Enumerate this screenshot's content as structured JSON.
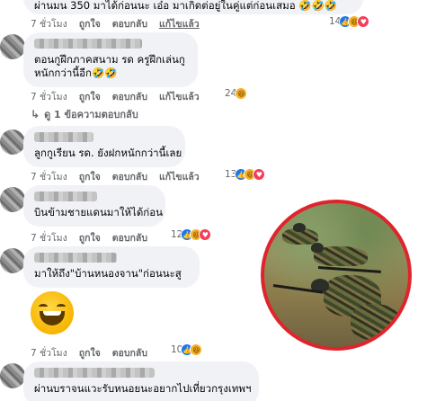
{
  "comments": [
    {
      "text": "ผ่านมน 350 มาได้ก่อนนะ เอ๋อ มาเกิดต่อยู่ในคู่แต่ก่อนเสมอ 🤣🤣🤣",
      "time": "7 ชั่วโมง",
      "like": "ถูกใจ",
      "reply": "ตอบกลับ",
      "edited": "แก้ไขแล้ว",
      "reaction_count": "14"
    },
    {
      "text": "ตอนกูฝึกภาคสนาม รด ครูฝึกเล่นกู หนักกว่านี้อีก 🤣🤣",
      "text_line1": "ตอนกูฝึกภาคสนาม รด ครูฝึกเล่นกู",
      "text_line2": "หนักกว่านี้อีก🤣🤣",
      "time": "7 ชั่วโมง",
      "like": "ถูกใจ",
      "reply": "ตอบกลับ",
      "edited": "แก้ไขแล้ว",
      "reaction_count": "24"
    },
    {
      "text": "ลูกกูเรียน รด. ยังฝกหนักกว่านี้เลย",
      "time": "7 ชั่วโมง",
      "like": "ถูกใจ",
      "reply": "ตอบกลับ",
      "edited": "แก้ไขแล้ว",
      "reaction_count": "13"
    },
    {
      "text": "บินข้ามชายแดนมาให้ได้ก่อน",
      "time": "7 ชั่วโมง",
      "like": "ถูกใจ",
      "reply": "ตอบกลับ",
      "reaction_count": "12"
    },
    {
      "text": "มาให้ถึง\"บ้านหนองจาน\"ก่อนนะสู",
      "time": "7 ชั่วโมง",
      "like": "ถูกใจ",
      "reply": "ตอบกลับ",
      "reaction_count": "10"
    },
    {
      "text": "ผ่านบราจนแวะรับหนอยนะอยากไปเที่ยวกรุงเทพฯ"
    }
  ],
  "view_replies": "ดู 1 ข้อความตอบกลับ",
  "icons": {
    "like": "like-reaction-icon",
    "haha": "haha-reaction-icon",
    "love": "love-reaction-icon",
    "reply_arrow": "reply-arrow-icon",
    "sticker": "laughing-emoji-sticker"
  },
  "colors": {
    "bubble": "#f0f2f5",
    "meta": "#65676b",
    "like": "#1877f2",
    "haha": "#f7b125",
    "love": "#f33e58",
    "photo_border": "#e0242c"
  }
}
